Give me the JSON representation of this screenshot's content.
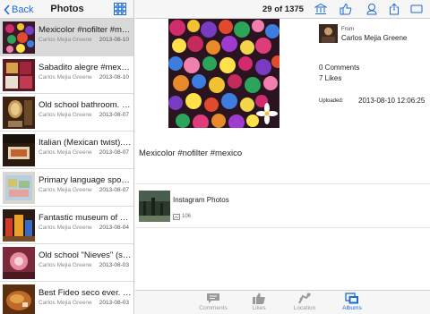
{
  "sidebar": {
    "back_label": "Back",
    "title": "Photos",
    "items": [
      {
        "title": "Mexicolor #nofilter #me...",
        "author": "Carlos Mejia Greene",
        "date": "2013-08-10",
        "selected": true
      },
      {
        "title": "Sabadito alegre #mexico",
        "author": "Carlos Mejia Greene",
        "date": "2013-08-10",
        "selected": false
      },
      {
        "title": "Old school bathroom. #...",
        "author": "Carlos Mejia Greene",
        "date": "2013-08-07",
        "selected": false
      },
      {
        "title": "Italian (Mexican twist). B...",
        "author": "Carlos Mejia Greene",
        "date": "2013-08-07",
        "selected": false
      },
      {
        "title": "Primary language spoke...",
        "author": "Carlos Mejia Greene",
        "date": "2013-08-07",
        "selected": false
      },
      {
        "title": "Fantastic museum of M...",
        "author": "Carlos Mejia Greene",
        "date": "2013-08-04",
        "selected": false
      },
      {
        "title": "Old school \"Nieves\" (sor...",
        "author": "Carlos Mejia Greene",
        "date": "2013-08-03",
        "selected": false
      },
      {
        "title": "Best Fideo seco ever. I...",
        "author": "Carlos Mejia Greene",
        "date": "2013-08-03",
        "selected": false
      }
    ]
  },
  "toolbar": {
    "counter": "29 of 1375"
  },
  "photo": {
    "from_label": "From",
    "from_name": "Carlos Mejia Greene",
    "comments": "0 Comments",
    "likes": "7 Likes",
    "uploaded_label": "Uploaded:",
    "uploaded_value": "2013-08-10 12:06:25",
    "caption": "Mexicolor #nofilter #mexico"
  },
  "album": {
    "title": "Instagram Photos",
    "count": "106"
  },
  "tabbar": {
    "tabs": [
      {
        "label": "Comments",
        "icon": "comments-icon"
      },
      {
        "label": "Likes",
        "icon": "likes-icon"
      },
      {
        "label": "Location",
        "icon": "location-icon"
      },
      {
        "label": "Albums",
        "icon": "albums-icon",
        "active": true
      }
    ]
  },
  "colors": {
    "accent": "#1b6bd6",
    "bar_background": "#f6f6f6",
    "selected_row": "#d9d9d9"
  }
}
